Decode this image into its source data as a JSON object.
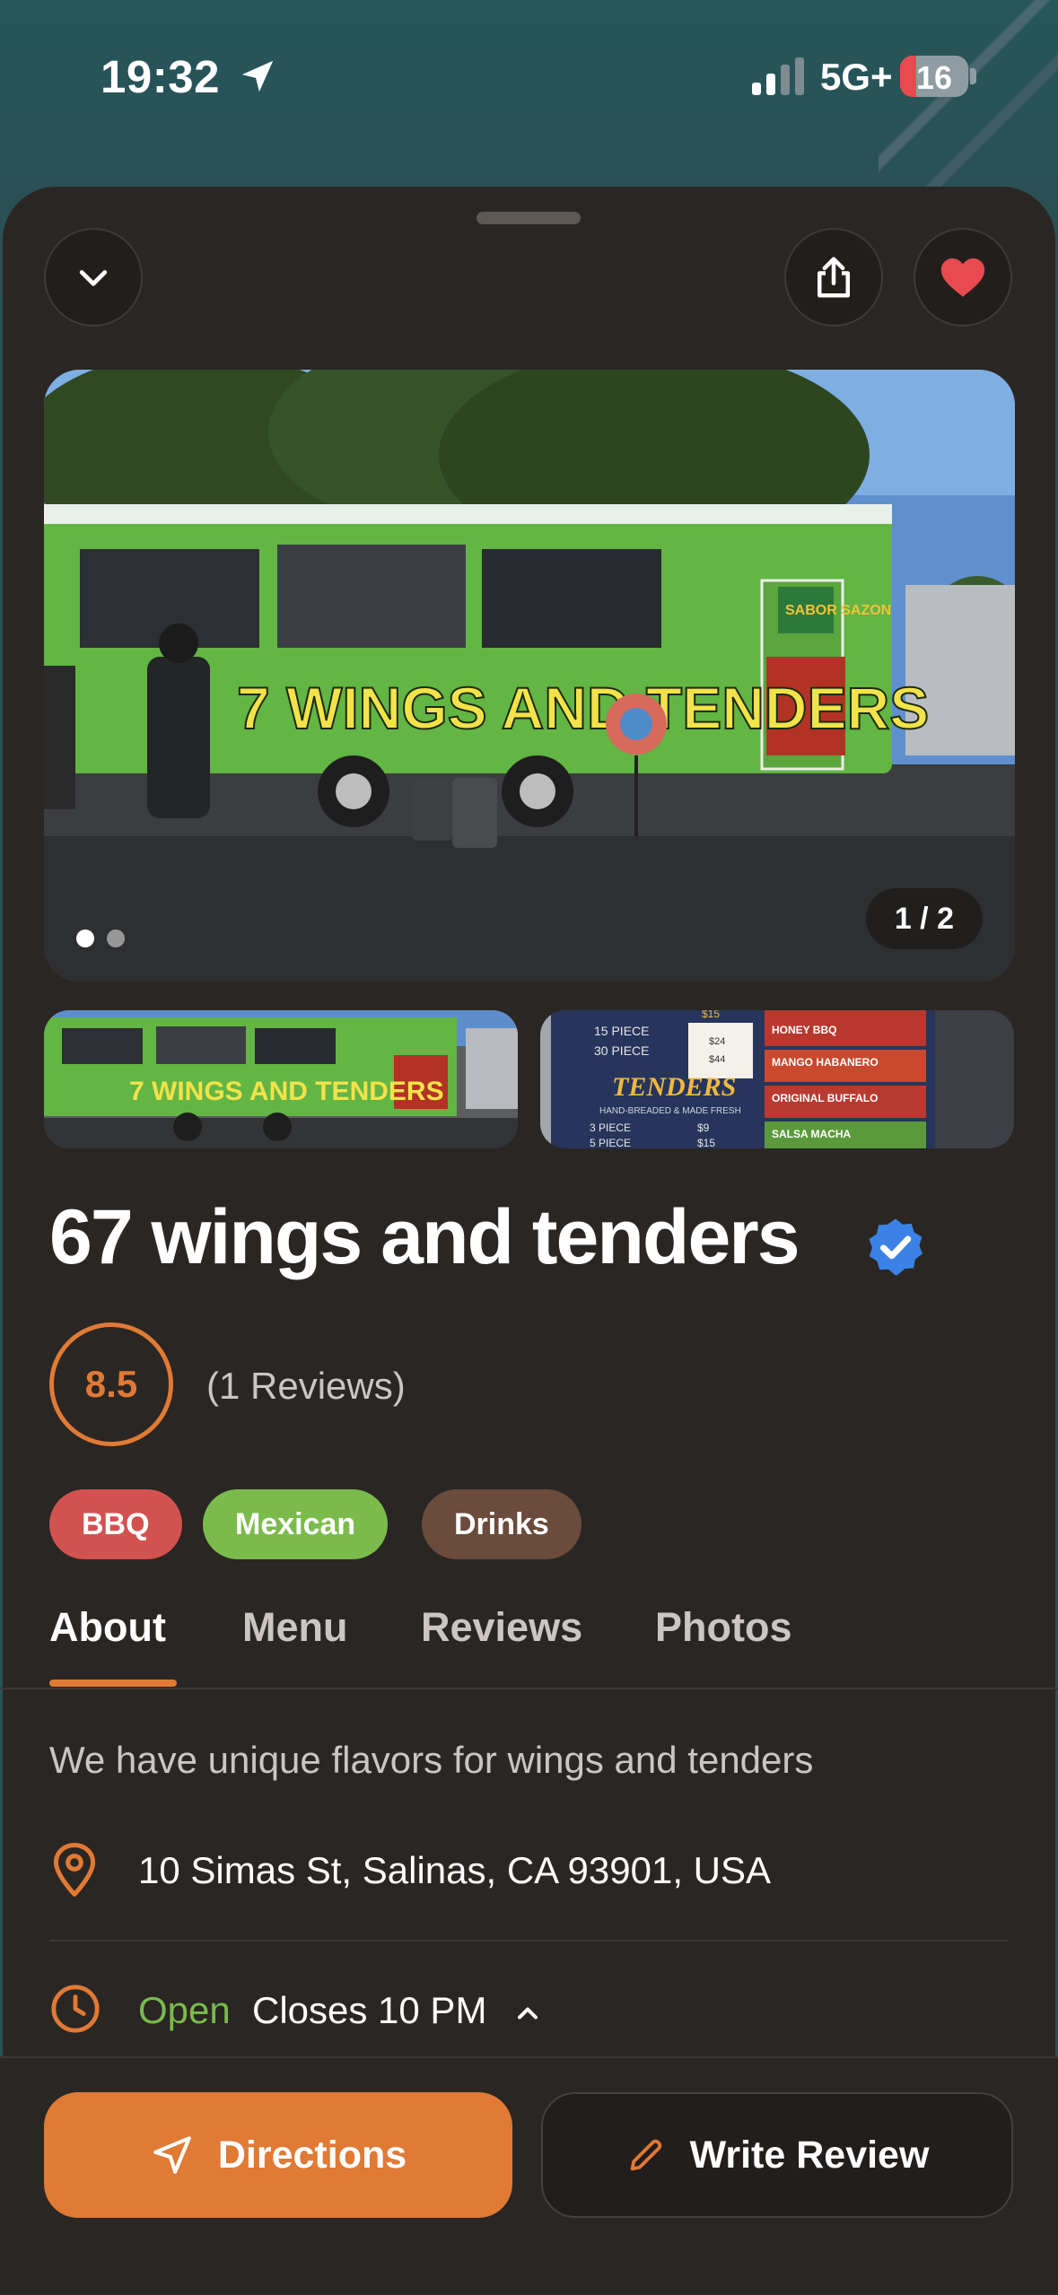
{
  "status_bar": {
    "time": "19:32",
    "network": "5G+",
    "battery": "16"
  },
  "photos": {
    "counter": "1 / 2",
    "count": 2,
    "active_index": 0,
    "hero_truck_text": "7 WINGS AND TENDERS",
    "hero_sign_text": "SABOR SAZON",
    "menu_title": "TENDERS",
    "menu_subtitle": "HAND-BREADED & MADE FRESH",
    "menu_rows": [
      "15 PIECE",
      "30 PIECE",
      "3 PIECE",
      "5 PIECE"
    ],
    "menu_prices": [
      "$15",
      "$24",
      "$44",
      "$9",
      "$15"
    ],
    "menu_sauces": [
      "HONEY BBQ",
      "MANGO HABANERO",
      "ORIGINAL BUFFALO",
      "SALSA MACHA"
    ]
  },
  "restaurant": {
    "name": "67 wings and tenders",
    "rating": "8.5",
    "reviews_label": "(1 Reviews)",
    "tags": [
      {
        "label": "BBQ",
        "color": "#d2524f"
      },
      {
        "label": "Mexican",
        "color": "#7bbb4c"
      },
      {
        "label": "Drinks",
        "color": "#6a4b3c"
      }
    ]
  },
  "tabs": [
    {
      "label": "About",
      "active": true
    },
    {
      "label": "Menu",
      "active": false
    },
    {
      "label": "Reviews",
      "active": false
    },
    {
      "label": "Photos",
      "active": false
    }
  ],
  "about": {
    "description": "We have unique flavors for wings and tenders",
    "address": "10 Simas St, Salinas, CA 93901, USA",
    "status_open": "Open",
    "closes": "Closes 10 PM"
  },
  "actions": {
    "directions": "Directions",
    "write_review": "Write Review"
  },
  "icons": {
    "collapse": "chevron-down-icon",
    "share": "share-icon",
    "favorite": "heart-icon",
    "verified": "verified-badge-icon",
    "location": "map-pin-icon",
    "hours": "clock-icon",
    "directions": "navigation-arrow-icon",
    "review": "pencil-icon"
  },
  "colors": {
    "accent": "#e07a35",
    "open": "#7bbb4c",
    "favorite": "#e84a4f",
    "verified": "#3b82e6",
    "sheet_bg": "#2a2623"
  }
}
